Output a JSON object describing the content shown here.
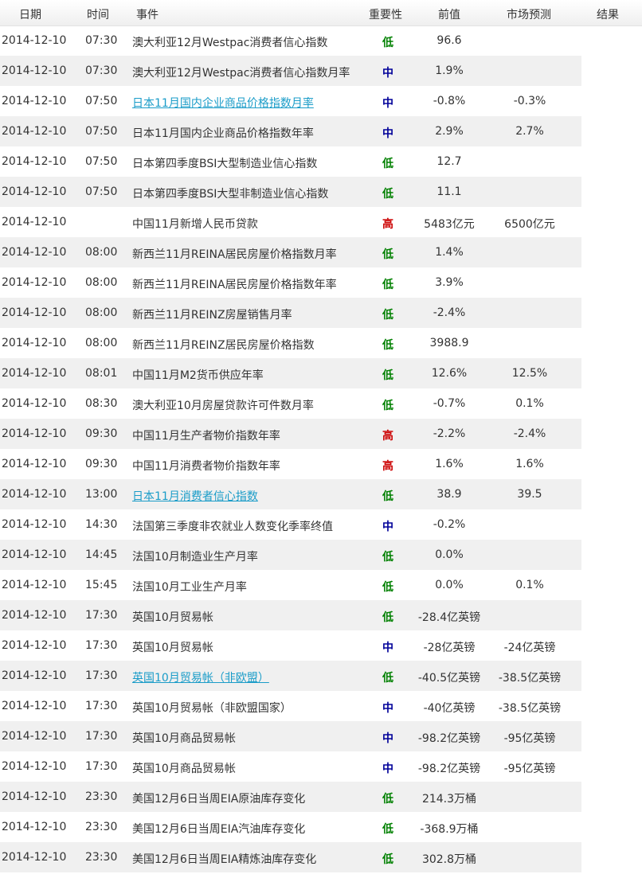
{
  "header": {
    "date": "日期",
    "time": "时间",
    "event": "事件",
    "importance": "重要性",
    "previous": "前值",
    "forecast": "市场预测",
    "result": "结果"
  },
  "colors": {
    "低": "#008000",
    "中": "#000099",
    "高": "#cc0000",
    "link": "#1a9cc8",
    "alt_row": "#f0f0f0"
  },
  "rows": [
    {
      "date": "2014-12-10",
      "time": "07:30",
      "event": "澳大利亚12月Westpac消费者信心指数",
      "importance": "低",
      "previous": "96.6",
      "forecast": "",
      "result": "",
      "link": false
    },
    {
      "date": "2014-12-10",
      "time": "07:30",
      "event": "澳大利亚12月Westpac消费者信心指数月率",
      "importance": "中",
      "previous": "1.9%",
      "forecast": "",
      "result": "",
      "link": false
    },
    {
      "date": "2014-12-10",
      "time": "07:50",
      "event": "日本11月国内企业商品价格指数月率",
      "importance": "中",
      "previous": "-0.8%",
      "forecast": "-0.3%",
      "result": "",
      "link": true
    },
    {
      "date": "2014-12-10",
      "time": "07:50",
      "event": "日本11月国内企业商品价格指数年率",
      "importance": "中",
      "previous": "2.9%",
      "forecast": "2.7%",
      "result": "",
      "link": false
    },
    {
      "date": "2014-12-10",
      "time": "07:50",
      "event": "日本第四季度BSI大型制造业信心指数",
      "importance": "低",
      "previous": "12.7",
      "forecast": "",
      "result": "",
      "link": false
    },
    {
      "date": "2014-12-10",
      "time": "07:50",
      "event": "日本第四季度BSI大型非制造业信心指数",
      "importance": "低",
      "previous": "11.1",
      "forecast": "",
      "result": "",
      "link": false
    },
    {
      "date": "2014-12-10",
      "time": "",
      "event": "中国11月新增人民币贷款",
      "importance": "高",
      "previous": "5483亿元",
      "forecast": "6500亿元",
      "result": "",
      "link": false
    },
    {
      "date": "2014-12-10",
      "time": "08:00",
      "event": "新西兰11月REINA居民房屋价格指数月率",
      "importance": "低",
      "previous": "1.4%",
      "forecast": "",
      "result": "",
      "link": false
    },
    {
      "date": "2014-12-10",
      "time": "08:00",
      "event": "新西兰11月REINA居民房屋价格指数年率",
      "importance": "低",
      "previous": "3.9%",
      "forecast": "",
      "result": "",
      "link": false
    },
    {
      "date": "2014-12-10",
      "time": "08:00",
      "event": "新西兰11月REINZ房屋销售月率",
      "importance": "低",
      "previous": "-2.4%",
      "forecast": "",
      "result": "",
      "link": false
    },
    {
      "date": "2014-12-10",
      "time": "08:00",
      "event": "新西兰11月REINZ居民房屋价格指数",
      "importance": "低",
      "previous": "3988.9",
      "forecast": "",
      "result": "",
      "link": false
    },
    {
      "date": "2014-12-10",
      "time": "08:01",
      "event": "中国11月M2货币供应年率",
      "importance": "低",
      "previous": "12.6%",
      "forecast": "12.5%",
      "result": "",
      "link": false
    },
    {
      "date": "2014-12-10",
      "time": "08:30",
      "event": "澳大利亚10月房屋贷款许可件数月率",
      "importance": "低",
      "previous": "-0.7%",
      "forecast": "0.1%",
      "result": "",
      "link": false
    },
    {
      "date": "2014-12-10",
      "time": "09:30",
      "event": "中国11月生产者物价指数年率",
      "importance": "高",
      "previous": "-2.2%",
      "forecast": "-2.4%",
      "result": "",
      "link": false
    },
    {
      "date": "2014-12-10",
      "time": "09:30",
      "event": "中国11月消费者物价指数年率",
      "importance": "高",
      "previous": "1.6%",
      "forecast": "1.6%",
      "result": "",
      "link": false
    },
    {
      "date": "2014-12-10",
      "time": "13:00",
      "event": "日本11月消费者信心指数",
      "importance": "低",
      "previous": "38.9",
      "forecast": "39.5",
      "result": "",
      "link": true
    },
    {
      "date": "2014-12-10",
      "time": "14:30",
      "event": "法国第三季度非农就业人数变化季率终值",
      "importance": "中",
      "previous": "-0.2%",
      "forecast": "",
      "result": "",
      "link": false
    },
    {
      "date": "2014-12-10",
      "time": "14:45",
      "event": "法国10月制造业生产月率",
      "importance": "低",
      "previous": "0.0%",
      "forecast": "",
      "result": "",
      "link": false
    },
    {
      "date": "2014-12-10",
      "time": "15:45",
      "event": "法国10月工业生产月率",
      "importance": "低",
      "previous": "0.0%",
      "forecast": "0.1%",
      "result": "",
      "link": false
    },
    {
      "date": "2014-12-10",
      "time": "17:30",
      "event": "英国10月贸易帐",
      "importance": "低",
      "previous": "-28.4亿英镑",
      "forecast": "",
      "result": "",
      "link": false
    },
    {
      "date": "2014-12-10",
      "time": "17:30",
      "event": "英国10月贸易帐",
      "importance": "中",
      "previous": "-28亿英镑",
      "forecast": "-24亿英镑",
      "result": "",
      "link": false
    },
    {
      "date": "2014-12-10",
      "time": "17:30",
      "event": "英国10月贸易帐（非欧盟）",
      "importance": "低",
      "previous": "-40.5亿英镑",
      "forecast": "-38.5亿英镑",
      "result": "",
      "link": true
    },
    {
      "date": "2014-12-10",
      "time": "17:30",
      "event": "英国10月贸易帐（非欧盟国家）",
      "importance": "中",
      "previous": "-40亿英镑",
      "forecast": "-38.5亿英镑",
      "result": "",
      "link": false
    },
    {
      "date": "2014-12-10",
      "time": "17:30",
      "event": "英国10月商品贸易帐",
      "importance": "中",
      "previous": "-98.2亿英镑",
      "forecast": "-95亿英镑",
      "result": "",
      "link": false
    },
    {
      "date": "2014-12-10",
      "time": "17:30",
      "event": "英国10月商品贸易帐",
      "importance": "中",
      "previous": "-98.2亿英镑",
      "forecast": "-95亿英镑",
      "result": "",
      "link": false
    },
    {
      "date": "2014-12-10",
      "time": "23:30",
      "event": "美国12月6日当周EIA原油库存变化",
      "importance": "低",
      "previous": "214.3万桶",
      "forecast": "",
      "result": "",
      "link": false
    },
    {
      "date": "2014-12-10",
      "time": "23:30",
      "event": "美国12月6日当周EIA汽油库存变化",
      "importance": "低",
      "previous": "-368.9万桶",
      "forecast": "",
      "result": "",
      "link": false
    },
    {
      "date": "2014-12-10",
      "time": "23:30",
      "event": "美国12月6日当周EIA精炼油库存变化",
      "importance": "低",
      "previous": "302.8万桶",
      "forecast": "",
      "result": "",
      "link": false
    }
  ]
}
